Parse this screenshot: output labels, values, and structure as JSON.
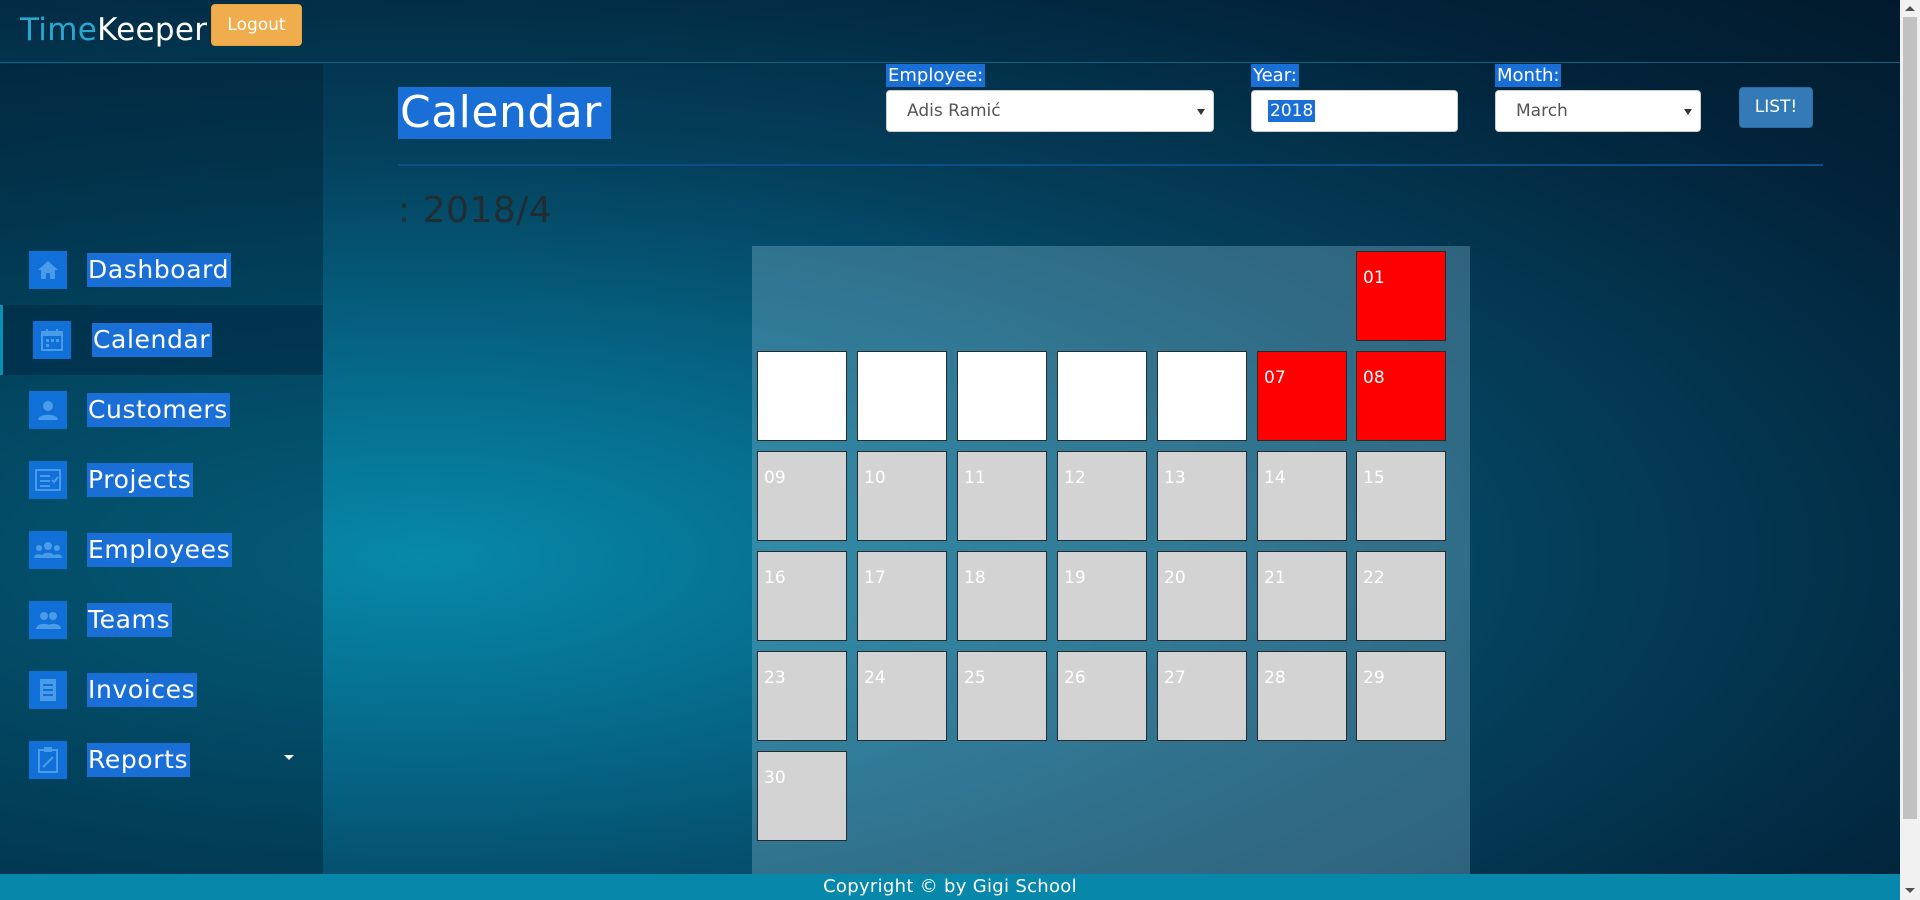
{
  "app": {
    "brand_part1": "Time",
    "brand_part2": "Keeper",
    "logout_label": "Logout"
  },
  "sidebar": {
    "items": [
      {
        "label": "Dashboard",
        "icon": "home-icon"
      },
      {
        "label": "Calendar",
        "icon": "calendar-icon",
        "active": true
      },
      {
        "label": "Customers",
        "icon": "person-icon"
      },
      {
        "label": "Projects",
        "icon": "checklist-icon"
      },
      {
        "label": "Employees",
        "icon": "group-icon"
      },
      {
        "label": "Teams",
        "icon": "people-icon"
      },
      {
        "label": "Invoices",
        "icon": "document-icon"
      },
      {
        "label": "Reports",
        "icon": "clipboard-icon",
        "has_dropdown": true
      }
    ]
  },
  "main": {
    "title": "Calendar",
    "filters": {
      "employee_label": "Employee:",
      "employee_value": "Adis Ramić",
      "year_label": "Year:",
      "year_value": "2018",
      "month_label": "Month:",
      "month_value": "March",
      "submit_label": "LIST!"
    },
    "period": ": 2018/4"
  },
  "calendar": {
    "days": [
      {
        "label": "01",
        "status": "red"
      },
      {
        "label": "",
        "status": "white"
      },
      {
        "label": "",
        "status": "white"
      },
      {
        "label": "",
        "status": "white"
      },
      {
        "label": "",
        "status": "white"
      },
      {
        "label": "",
        "status": "white"
      },
      {
        "label": "07",
        "status": "red"
      },
      {
        "label": "08",
        "status": "red"
      },
      {
        "label": "09",
        "status": "gray"
      },
      {
        "label": "10",
        "status": "gray"
      },
      {
        "label": "11",
        "status": "gray"
      },
      {
        "label": "12",
        "status": "gray"
      },
      {
        "label": "13",
        "status": "gray"
      },
      {
        "label": "14",
        "status": "gray"
      },
      {
        "label": "15",
        "status": "gray"
      },
      {
        "label": "16",
        "status": "gray"
      },
      {
        "label": "17",
        "status": "gray"
      },
      {
        "label": "18",
        "status": "gray"
      },
      {
        "label": "19",
        "status": "gray"
      },
      {
        "label": "20",
        "status": "gray"
      },
      {
        "label": "21",
        "status": "gray"
      },
      {
        "label": "22",
        "status": "gray"
      },
      {
        "label": "23",
        "status": "gray"
      },
      {
        "label": "24",
        "status": "gray"
      },
      {
        "label": "25",
        "status": "gray"
      },
      {
        "label": "26",
        "status": "gray"
      },
      {
        "label": "27",
        "status": "gray"
      },
      {
        "label": "28",
        "status": "gray"
      },
      {
        "label": "29",
        "status": "gray"
      },
      {
        "label": "30",
        "status": "gray"
      }
    ]
  },
  "footer": {
    "text": "Copyright © by Gigi School"
  },
  "colors": {
    "accent": "#1a6fd6",
    "logout": "#f0ad4e",
    "day_red": "#ff0000",
    "day_gray": "#d3d3d3",
    "day_white": "#ffffff",
    "footer": "#0787a9"
  }
}
